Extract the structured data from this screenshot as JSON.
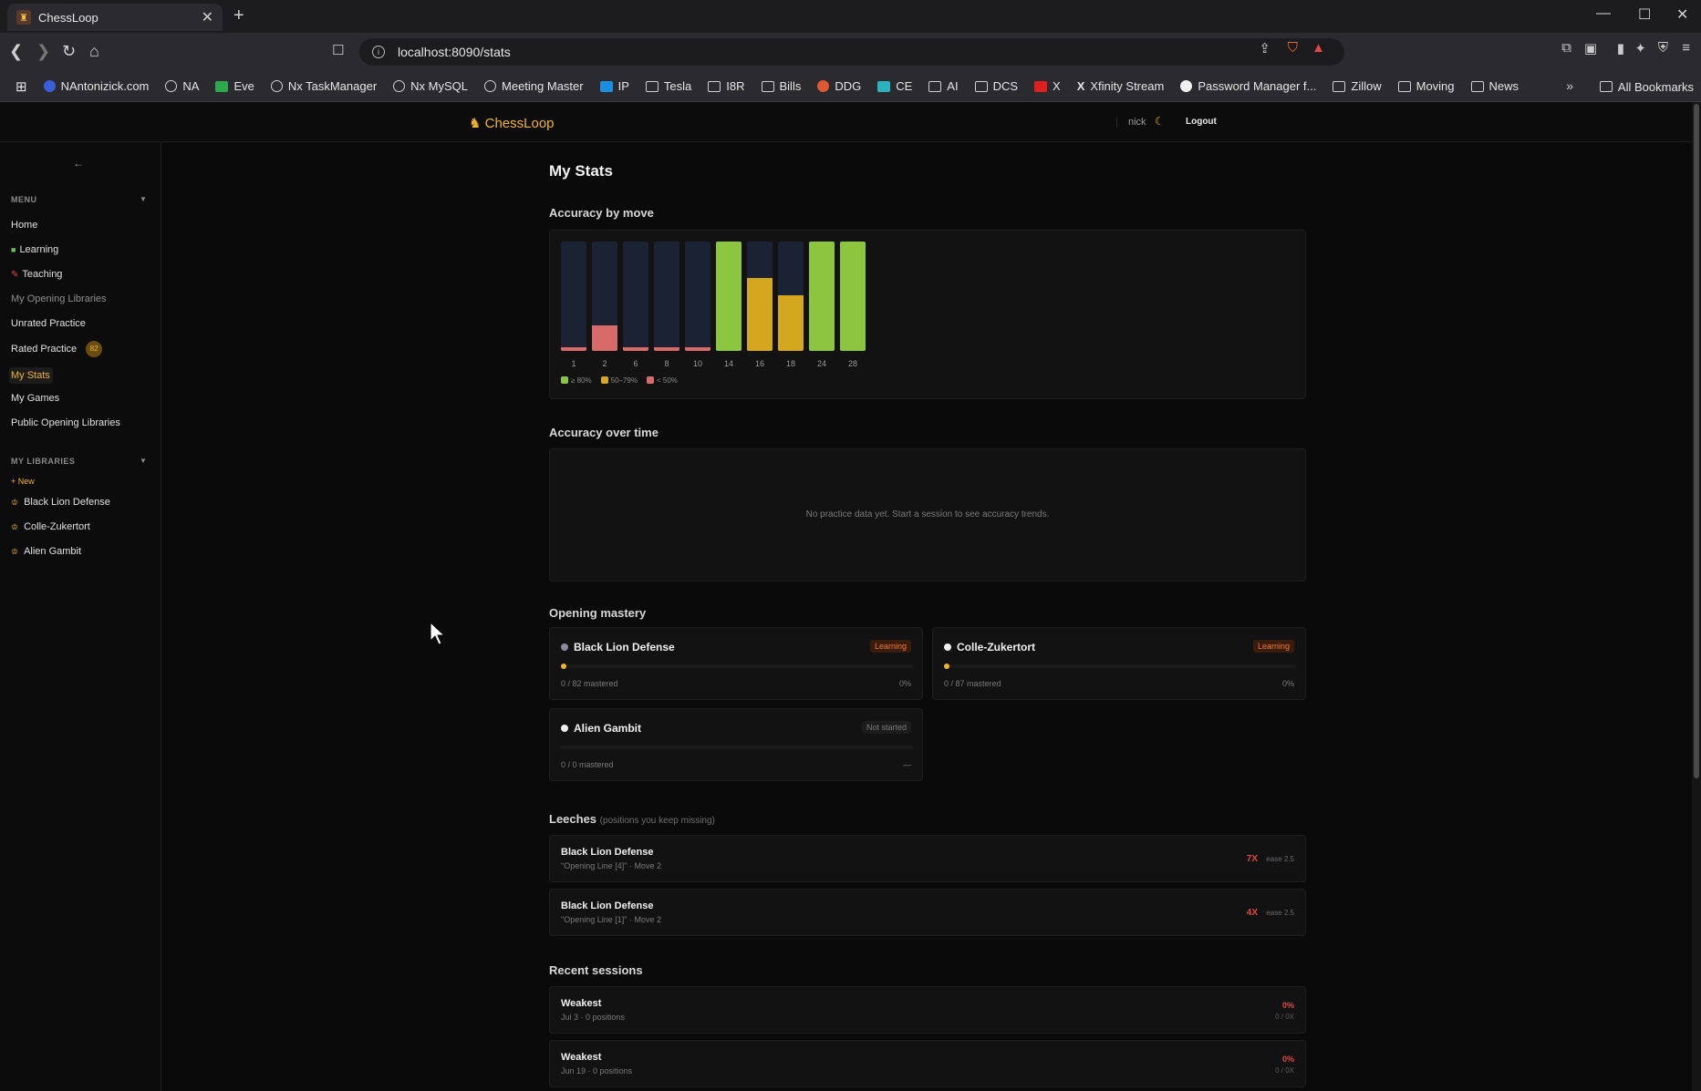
{
  "browser": {
    "tab_title": "ChessLoop",
    "url": "localhost:8090/stats",
    "bookmarks": [
      "NAntonizick.com",
      "NA",
      "Eve",
      "Nx TaskManager",
      "Nx MySQL",
      "Meeting Master",
      "IP",
      "Tesla",
      "I8R",
      "Bills",
      "DDG",
      "CE",
      "AI",
      "DCS",
      "X",
      "Xfinity Stream",
      "Password Manager f...",
      "Zillow",
      "Moving",
      "News"
    ],
    "all_bookmarks": "All Bookmarks"
  },
  "app": {
    "brand": "ChessLoop",
    "user": "nick",
    "logout": "Logout"
  },
  "sidebar": {
    "menu_title": "MENU",
    "items": [
      {
        "label": "Home"
      },
      {
        "label": "Learning"
      },
      {
        "label": "Teaching"
      },
      {
        "label": "My Opening Libraries"
      },
      {
        "label": "Unrated Practice"
      },
      {
        "label": "Rated Practice",
        "badge": "82"
      },
      {
        "label": "My Stats"
      },
      {
        "label": "My Games"
      },
      {
        "label": "Public Opening Libraries"
      }
    ],
    "libraries_title": "MY LIBRARIES",
    "new_label": "+ New",
    "libraries": [
      "Black Lion Defense",
      "Colle-Zukertort",
      "Alien Gambit"
    ]
  },
  "main": {
    "title": "My Stats",
    "accuracy_by_move": "Accuracy by move",
    "accuracy_over_time": "Accuracy over time",
    "no_data": "No practice data yet. Start a session to see accuracy trends.",
    "opening_mastery": "Opening mastery",
    "leeches_title": "Leeches",
    "leeches_sub": "(positions you keep missing)",
    "recent_sessions": "Recent sessions"
  },
  "chart_data": {
    "type": "bar",
    "categories": [
      "1",
      "2",
      "6",
      "8",
      "10",
      "14",
      "16",
      "18",
      "24",
      "28"
    ],
    "values": [
      3,
      23,
      3,
      3,
      3,
      100,
      67,
      51,
      100,
      100
    ],
    "ylim": [
      0,
      100
    ],
    "legend": [
      "≥ 80%",
      "50–79%",
      "< 50%"
    ],
    "colors": {
      "high": "#8cc63f",
      "mid": "#d4a81e",
      "low": "#d86a6a",
      "track": "#1b2233"
    }
  },
  "mastery": [
    {
      "name": "Black Lion Defense",
      "status": "Learning",
      "meta": "0 / 82 mastered",
      "pct": "0%",
      "progress": 0
    },
    {
      "name": "Colle-Zukertort",
      "status": "Learning",
      "meta": "0 / 87 mastered",
      "pct": "0%",
      "progress": 0
    },
    {
      "name": "Alien Gambit",
      "status": "Not started",
      "meta": "0 / 0 mastered",
      "pct": "—",
      "progress": 0
    }
  ],
  "leeches": [
    {
      "title": "Black Lion Defense",
      "sub": "\"Opening Line [4]\" · Move 2",
      "count": "7X",
      "ease": "ease 2.5"
    },
    {
      "title": "Black Lion Defense",
      "sub": "\"Opening Line [1]\" · Move 2",
      "count": "4X",
      "ease": "ease 2.5"
    }
  ],
  "sessions": [
    {
      "title": "Weakest",
      "sub": "Jul 3 · 0 positions",
      "pct": "0%",
      "ratio": "0 / 0X"
    },
    {
      "title": "Weakest",
      "sub": "Jun 19 · 0 positions",
      "pct": "0%",
      "ratio": "0 / 0X"
    }
  ]
}
